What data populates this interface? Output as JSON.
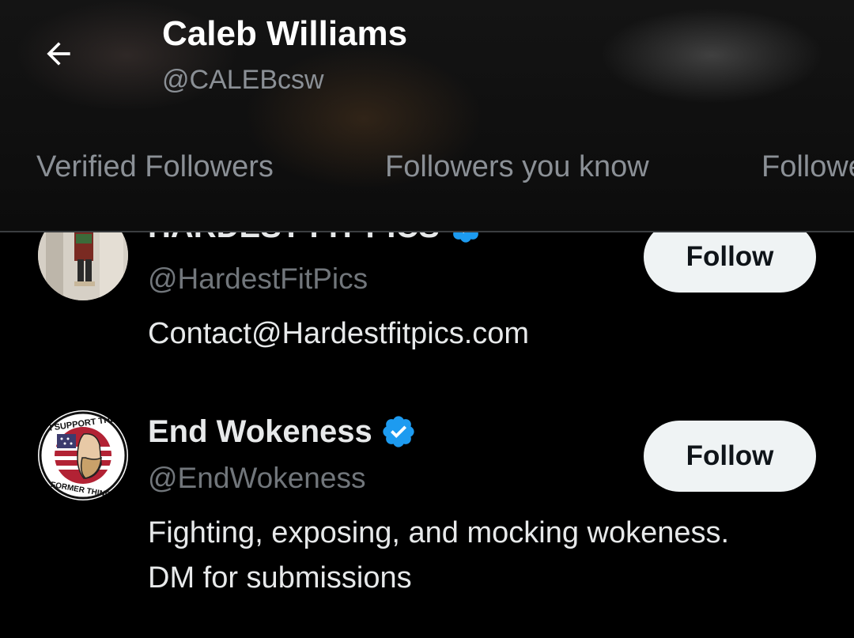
{
  "header": {
    "back_icon": "arrow-left-icon",
    "name": "Caleb Williams",
    "handle": "@CALEBcsw"
  },
  "tabs": [
    {
      "label": "Verified Followers"
    },
    {
      "label": "Followers you know"
    },
    {
      "label": "Followers"
    }
  ],
  "accounts": [
    {
      "name": "HARDEST FIT PICS",
      "handle": "@HardestFitPics",
      "bio": "Contact@Hardestfitpics.com",
      "verified": true,
      "button_label": "Follow"
    },
    {
      "name": "End Wokeness",
      "handle": "@EndWokeness",
      "bio_lines": [
        "Fighting, exposing, and mocking wokeness.",
        "DM for submissions"
      ],
      "verified": true,
      "button_label": "Follow",
      "avatar_text_top": "I SUPPORT THE",
      "avatar_text_bottom": "FORMER THINGS"
    }
  ],
  "colors": {
    "background": "#000000",
    "primary_text": "#e7e9ea",
    "secondary_text": "#71767b",
    "verified_blue": "#1d9bf0",
    "button_bg": "#eff3f4"
  }
}
